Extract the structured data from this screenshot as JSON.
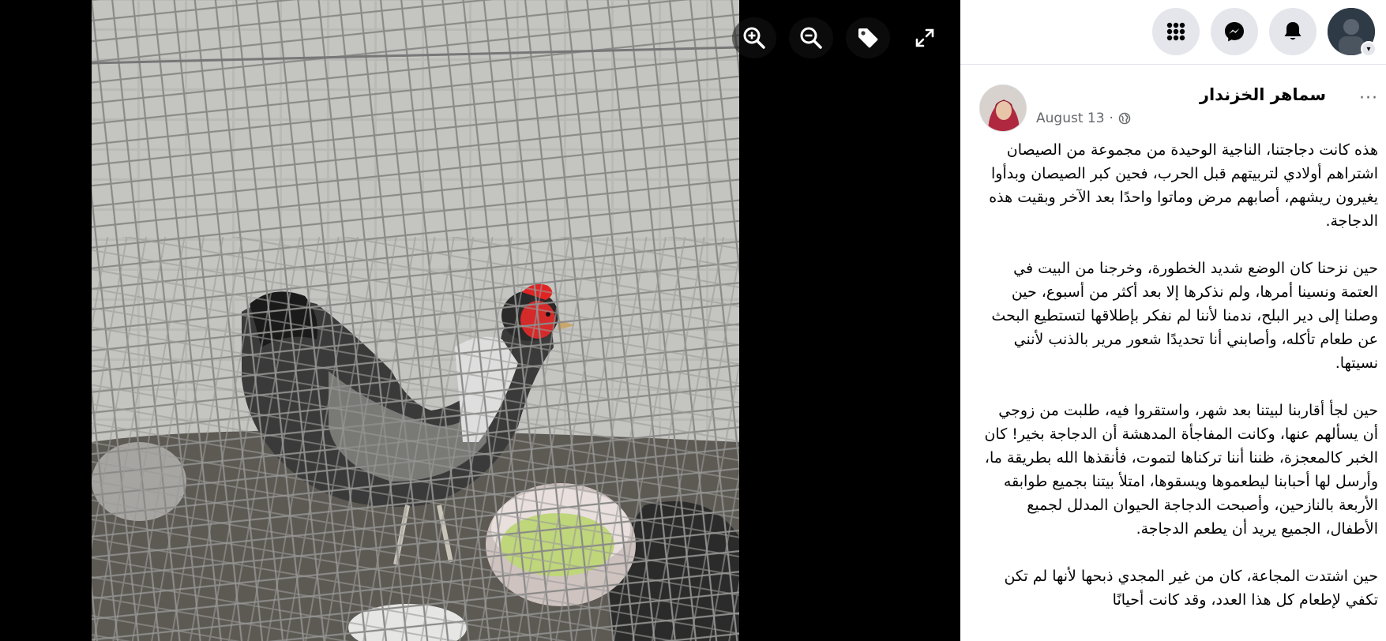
{
  "viewer": {
    "tools": [
      {
        "name": "zoom-in-icon"
      },
      {
        "name": "zoom-out-icon"
      },
      {
        "name": "tag-icon"
      },
      {
        "name": "fullscreen-icon"
      }
    ]
  },
  "topbar": {
    "icons": [
      "menu-grid-icon",
      "messenger-icon",
      "notifications-icon",
      "account-avatar"
    ]
  },
  "post": {
    "author": "سماهر الخزندار",
    "date": "August 13",
    "separator": "·",
    "more": "···",
    "paragraphs": [
      "هذه كانت دجاجتنا، الناجية الوحيدة من مجموعة من الصيصان اشتراهم أولادي لتربيتهم قبل الحرب، فحين كبر الصيصان وبدأوا يغيرون ريشهم، أصابهم مرض وماتوا واحدًا بعد الآخر وبقيت هذه الدجاجة.",
      "حين نزحنا كان الوضع شديد الخطورة، وخرجنا من البيت في العتمة ونسينا أمرها، ولم نذكرها إلا بعد أكثر من أسبوع، حين وصلنا إلى دير البلح، ندمنا لأننا لم نفكر بإطلاقها لتستطيع البحث عن طعام تأكله، وأصابني أنا تحديدًا شعور مرير بالذنب لأنني نسيتها.",
      "حين لجأ أقاربنا لبيتنا بعد شهر، واستقروا فيه، طلبت من زوجي أن يسألهم عنها، وكانت المفاجأة المدهشة أن الدجاجة بخير! كان الخبر كالمعجزة، ظننا أننا تركناها لتموت، فأنقذها الله بطريقة ما، وأرسل لها أحبابنا ليطعموها ويسقوها، امتلأ بيتنا بجميع طوابقه الأربعة بالنازحين، وأصبحت الدجاجة الحيوان المدلل لجميع الأطفال، الجميع يريد أن يطعم الدجاجة.",
      "حين اشتدت المجاعة، كان من غير المجدي ذبحها لأنها لم تكن تكفي لإطعام كل هذا العدد، وقد كانت أحيانًا"
    ]
  },
  "colors": {
    "sidebar_bg": "#ffffff",
    "icon_button_bg": "#e4e6eb",
    "meta_text": "#65676b",
    "text": "#050505"
  }
}
